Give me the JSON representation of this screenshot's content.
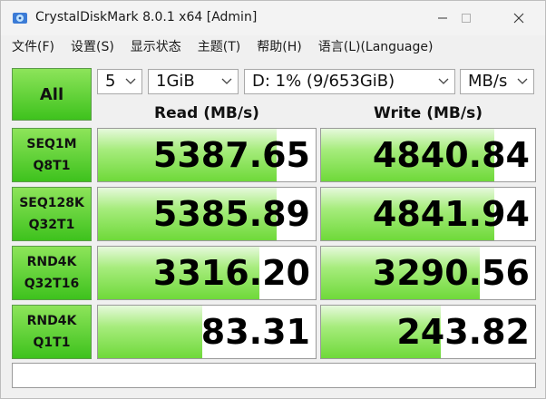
{
  "window": {
    "title": "CrystalDiskMark 8.0.1 x64 [Admin]"
  },
  "menu": [
    {
      "label": "文件(F)"
    },
    {
      "label": "设置(S)"
    },
    {
      "label": "显示状态"
    },
    {
      "label": "主题(T)"
    },
    {
      "label": "帮助(H)"
    },
    {
      "label": "语言(L)(Language)"
    }
  ],
  "controls": {
    "all_label": "All",
    "count": "5",
    "size": "1GiB",
    "drive": "D: 1% (9/653GiB)",
    "unit": "MB/s"
  },
  "headers": {
    "read": "Read (MB/s)",
    "write": "Write (MB/s)"
  },
  "tests": [
    {
      "line1": "SEQ1M",
      "line2": "Q8T1",
      "read": "5387.65",
      "write": "4840.84",
      "read_fill": 0.82,
      "write_fill": 0.81
    },
    {
      "line1": "SEQ128K",
      "line2": "Q32T1",
      "read": "5385.89",
      "write": "4841.94",
      "read_fill": 0.82,
      "write_fill": 0.81
    },
    {
      "line1": "RND4K",
      "line2": "Q32T16",
      "read": "3316.20",
      "write": "3290.56",
      "read_fill": 0.74,
      "write_fill": 0.74
    },
    {
      "line1": "RND4K",
      "line2": "Q1T1",
      "read": "83.31",
      "write": "243.82",
      "read_fill": 0.48,
      "write_fill": 0.56
    }
  ],
  "comment": "",
  "colors": {
    "accent_green": "#3ec21d",
    "fill_green": "#6fd93a"
  },
  "icons": {
    "app": "crystaldiskmark-icon",
    "minimize": "minimize-icon",
    "maximize": "maximize-icon",
    "close": "close-icon",
    "dropdown": "chevron-down-icon"
  }
}
